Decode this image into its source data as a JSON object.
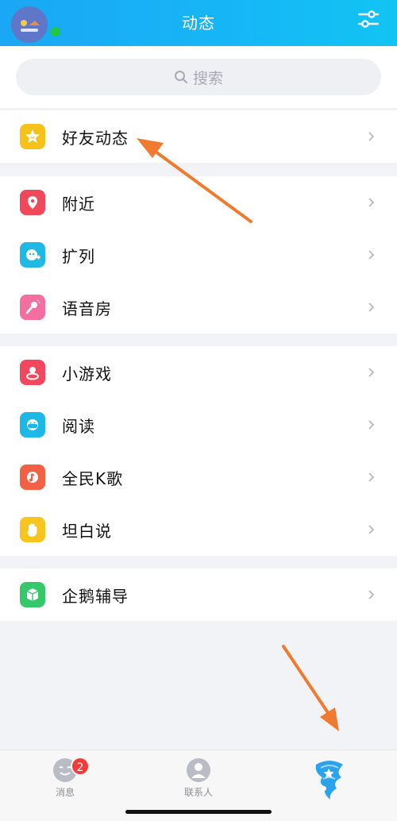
{
  "header": {
    "title": "动态",
    "avatar_icon": "user-avatar",
    "settings_icon": "sliders-icon"
  },
  "search": {
    "placeholder": "搜索"
  },
  "groups": [
    {
      "items": [
        {
          "label": "好友动态",
          "icon": "star-icon",
          "color": "#f6c21a"
        }
      ]
    },
    {
      "items": [
        {
          "label": "附近",
          "icon": "location-pin-icon",
          "color": "#f0485a"
        },
        {
          "label": "扩列",
          "icon": "add-friend-icon",
          "color": "#20b9e6"
        },
        {
          "label": "语音房",
          "icon": "microphone-icon",
          "color": "#f36fa2"
        }
      ]
    },
    {
      "items": [
        {
          "label": "小游戏",
          "icon": "game-icon",
          "color": "#f2475e"
        },
        {
          "label": "阅读",
          "icon": "book-mask-icon",
          "color": "#1cb9e8"
        },
        {
          "label": "全民K歌",
          "icon": "music-note-icon",
          "color": "#f26045"
        },
        {
          "label": "坦白说",
          "icon": "hand-icon",
          "color": "#f7c51e"
        }
      ]
    },
    {
      "items": [
        {
          "label": "企鹅辅导",
          "icon": "cube-icon",
          "color": "#35c86a"
        }
      ]
    }
  ],
  "tabbar": {
    "tabs": [
      {
        "label": "消息",
        "badge": "2",
        "icon": "message-face-icon"
      },
      {
        "label": "联系人",
        "icon": "contacts-icon"
      },
      {
        "label": "",
        "icon": "tornado-star-icon"
      }
    ]
  },
  "colors": {
    "accent": "#18b0f5",
    "arrow": "#f07a2e"
  }
}
